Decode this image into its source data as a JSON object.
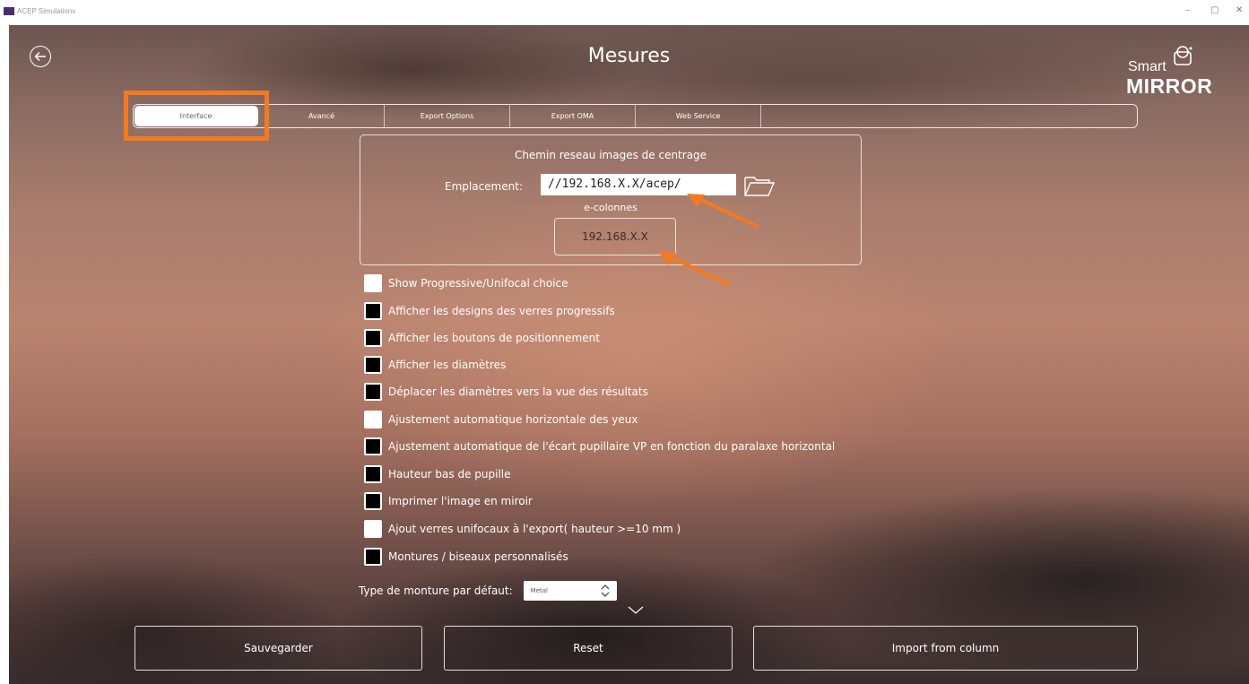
{
  "window": {
    "title": "ACEP Simulations",
    "controls": [
      "–",
      "▢",
      "✕"
    ]
  },
  "header": {
    "title": "Mesures",
    "logo_top": "Smart",
    "logo_bottom": "MIRROR"
  },
  "tabs": [
    {
      "label": "Interface",
      "active": true
    },
    {
      "label": "Avancé",
      "active": false
    },
    {
      "label": "Export Options",
      "active": false
    },
    {
      "label": "Export OMA",
      "active": false
    },
    {
      "label": "Web Service",
      "active": false
    }
  ],
  "network": {
    "heading": "Chemin reseau images de centrage",
    "location_label": "Emplacement:",
    "location_value": "//192.168.X.X/acep/",
    "ecolonnes_label": "e-colonnes",
    "ecolonnes_value": "192.168.X.X"
  },
  "options": [
    {
      "label": "Show Progressive/Unifocal choice",
      "checked": false
    },
    {
      "label": "Afficher les designs des verres progressifs",
      "checked": true
    },
    {
      "label": "Afficher les boutons de positionnement",
      "checked": true
    },
    {
      "label": "Afficher les diamètres",
      "checked": true
    },
    {
      "label": "Déplacer les diamètres vers la vue des résultats",
      "checked": true
    },
    {
      "label": "Ajustement automatique horizontale des yeux",
      "checked": false
    },
    {
      "label": "Ajustement automatique de l'écart pupillaire VP en fonction du paralaxe horizontal",
      "checked": true
    },
    {
      "label": "Hauteur bas de pupille",
      "checked": true
    },
    {
      "label": "Imprimer l'image en miroir",
      "checked": true
    },
    {
      "label": "Ajout verres unifocaux à l'export( hauteur >=10 mm )",
      "checked": false
    },
    {
      "label": "Montures / biseaux personnalisés",
      "checked": true
    }
  ],
  "frame_type": {
    "label": "Type de monture par défaut:",
    "value": "Metal"
  },
  "buttons": {
    "save": "Sauvegarder",
    "reset": "Reset",
    "import": "Import from column"
  },
  "colors": {
    "highlight": "#f47a20",
    "background": "#b98470"
  }
}
